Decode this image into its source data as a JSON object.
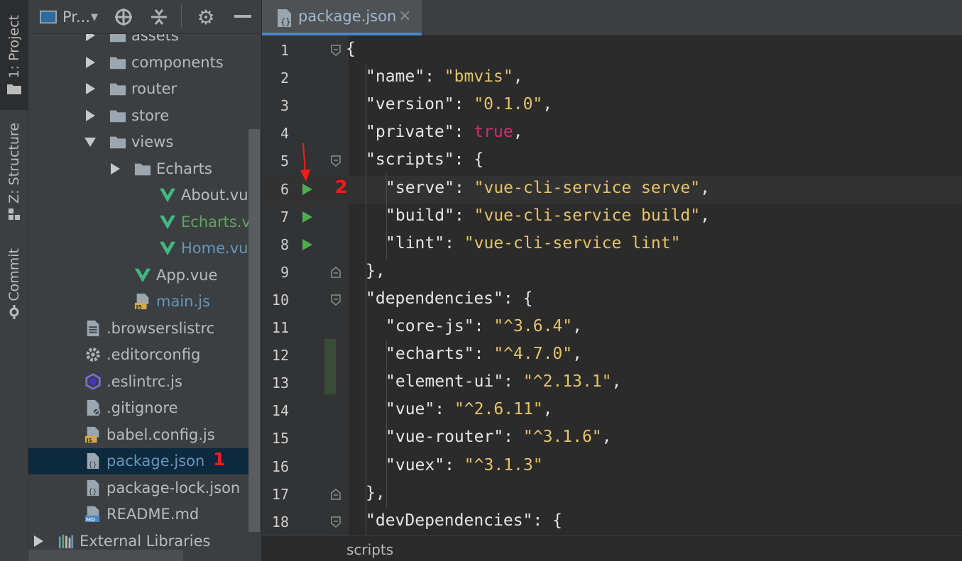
{
  "tool_strip": {
    "project_tab": "1: Project",
    "structure_tab": "Z: Structure",
    "commit_tab": "Commit"
  },
  "project_toolbar": {
    "view_label": "Pr...",
    "icons": [
      "project-view-icon",
      "locate-icon",
      "collapse-icon",
      "gear-icon",
      "minimize-icon"
    ]
  },
  "tree": [
    {
      "label": "assets",
      "type": "folder",
      "expand": "right",
      "color": "#bbbbbb"
    },
    {
      "label": "components",
      "type": "folder",
      "expand": "right",
      "color": "#bbbbbb"
    },
    {
      "label": "router",
      "type": "folder",
      "expand": "right",
      "color": "#bbbbbb"
    },
    {
      "label": "store",
      "type": "folder",
      "expand": "right",
      "color": "#bbbbbb"
    },
    {
      "label": "views",
      "type": "folder",
      "expand": "down",
      "color": "#bbbbbb"
    },
    {
      "label": "Echarts",
      "type": "folder",
      "expand": "right",
      "color": "#bbbbbb"
    },
    {
      "label": "About.vue",
      "type": "vue",
      "color": "#bbbbbb"
    },
    {
      "label": "Echarts.vue",
      "type": "vue",
      "color": "#62a362"
    },
    {
      "label": "Home.vue",
      "type": "vue",
      "color": "#6897bb"
    },
    {
      "label": "App.vue",
      "type": "vue",
      "color": "#bbbbbb"
    },
    {
      "label": "main.js",
      "type": "js",
      "color": "#6897bb"
    },
    {
      "label": ".browserslistrc",
      "type": "text",
      "color": "#bbbbbb"
    },
    {
      "label": ".editorconfig",
      "type": "gear",
      "color": "#bbbbbb"
    },
    {
      "label": ".eslintrc.js",
      "type": "eslint",
      "color": "#bbbbbb"
    },
    {
      "label": ".gitignore",
      "type": "ignore",
      "color": "#bbbbbb"
    },
    {
      "label": "babel.config.js",
      "type": "js",
      "color": "#bbbbbb"
    },
    {
      "label": "package.json",
      "type": "json",
      "color": "#6897bb",
      "selected": true,
      "annotation": "1"
    },
    {
      "label": "package-lock.json",
      "type": "json",
      "color": "#bbbbbb"
    },
    {
      "label": "README.md",
      "type": "md",
      "color": "#bbbbbb"
    },
    {
      "label": "External Libraries",
      "type": "libs",
      "expand": "right",
      "color": "#bbbbbb"
    }
  ],
  "editor": {
    "tab_label": "package.json",
    "tab_close": "×",
    "breadcrumb": "scripts",
    "annotation": "2",
    "lines": [
      {
        "n": "1",
        "parts": [
          [
            "p",
            "{"
          ]
        ],
        "fold": "open"
      },
      {
        "n": "2",
        "parts": [
          [
            "k",
            "\"name\""
          ],
          [
            "p",
            ": "
          ],
          [
            "s",
            "\"bmvis\""
          ],
          [
            "p",
            ","
          ]
        ]
      },
      {
        "n": "3",
        "parts": [
          [
            "k",
            "\"version\""
          ],
          [
            "p",
            ": "
          ],
          [
            "s",
            "\"0.1.0\""
          ],
          [
            "p",
            ","
          ]
        ]
      },
      {
        "n": "4",
        "parts": [
          [
            "k",
            "\"private\""
          ],
          [
            "p",
            ": "
          ],
          [
            "b",
            "true"
          ],
          [
            "p",
            ","
          ]
        ]
      },
      {
        "n": "5",
        "parts": [
          [
            "k",
            "\"scripts\""
          ],
          [
            "p",
            ": {"
          ]
        ],
        "fold": "open"
      },
      {
        "n": "6",
        "parts": [
          [
            "k",
            "\"serve\""
          ],
          [
            "p",
            ": "
          ],
          [
            "s",
            "\"vue-cli-service serve\""
          ],
          [
            "p",
            ","
          ]
        ],
        "run": true,
        "current": true
      },
      {
        "n": "7",
        "parts": [
          [
            "k",
            "\"build\""
          ],
          [
            "p",
            ": "
          ],
          [
            "s",
            "\"vue-cli-service build\""
          ],
          [
            "p",
            ","
          ]
        ],
        "run": true
      },
      {
        "n": "8",
        "parts": [
          [
            "k",
            "\"lint\""
          ],
          [
            "p",
            ": "
          ],
          [
            "s",
            "\"vue-cli-service lint\""
          ]
        ],
        "run": true
      },
      {
        "n": "9",
        "parts": [
          [
            "p",
            "},"
          ]
        ],
        "fold": "close"
      },
      {
        "n": "10",
        "parts": [
          [
            "k",
            "\"dependencies\""
          ],
          [
            "p",
            ": {"
          ]
        ],
        "fold": "open"
      },
      {
        "n": "11",
        "parts": [
          [
            "k",
            "\"core-js\""
          ],
          [
            "p",
            ": "
          ],
          [
            "s",
            "\"^3.6.4\""
          ],
          [
            "p",
            ","
          ]
        ]
      },
      {
        "n": "12",
        "parts": [
          [
            "k",
            "\"echarts\""
          ],
          [
            "p",
            ": "
          ],
          [
            "s",
            "\"^4.7.0\""
          ],
          [
            "p",
            ","
          ]
        ]
      },
      {
        "n": "13",
        "parts": [
          [
            "k",
            "\"element-ui\""
          ],
          [
            "p",
            ": "
          ],
          [
            "s",
            "\"^2.13.1\""
          ],
          [
            "p",
            ","
          ]
        ]
      },
      {
        "n": "14",
        "parts": [
          [
            "k",
            "\"vue\""
          ],
          [
            "p",
            ": "
          ],
          [
            "s",
            "\"^2.6.11\""
          ],
          [
            "p",
            ","
          ]
        ]
      },
      {
        "n": "15",
        "parts": [
          [
            "k",
            "\"vue-router\""
          ],
          [
            "p",
            ": "
          ],
          [
            "s",
            "\"^3.1.6\""
          ],
          [
            "p",
            ","
          ]
        ]
      },
      {
        "n": "16",
        "parts": [
          [
            "k",
            "\"vuex\""
          ],
          [
            "p",
            ": "
          ],
          [
            "s",
            "\"^3.1.3\""
          ]
        ]
      },
      {
        "n": "17",
        "parts": [
          [
            "p",
            "},"
          ]
        ],
        "fold": "close"
      },
      {
        "n": "18",
        "parts": [
          [
            "k",
            "\"devDependencies\""
          ],
          [
            "p",
            ": {"
          ]
        ],
        "fold": "open"
      }
    ]
  }
}
